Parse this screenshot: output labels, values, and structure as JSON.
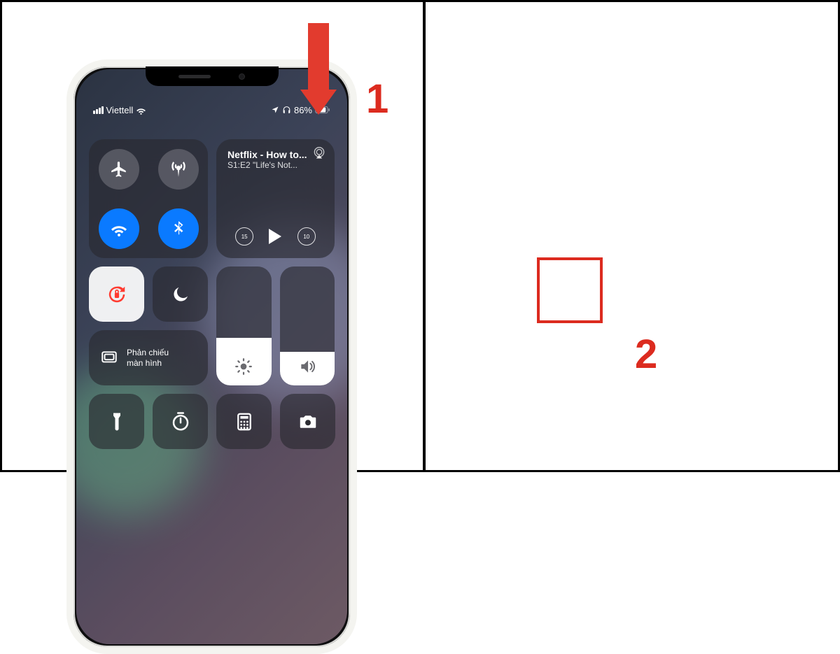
{
  "annotations": {
    "step1": "1",
    "step2": "2"
  },
  "status": {
    "carrier": "Viettell",
    "battery": "86%"
  },
  "media": {
    "title": "Netflix - How to...",
    "subtitle": "S1:E2 \"Life's Not...",
    "back_seconds": "15",
    "fwd_seconds": "10"
  },
  "screen_mirror": {
    "line1": "Phản chiếu",
    "line2": "màn hình"
  },
  "sliders": {
    "brightness_pct": 40,
    "volume_pct": 28
  },
  "colors": {
    "accent_red": "#dc2b1f",
    "ios_blue": "#0a7aff",
    "orientation_red": "#ff3b30"
  }
}
